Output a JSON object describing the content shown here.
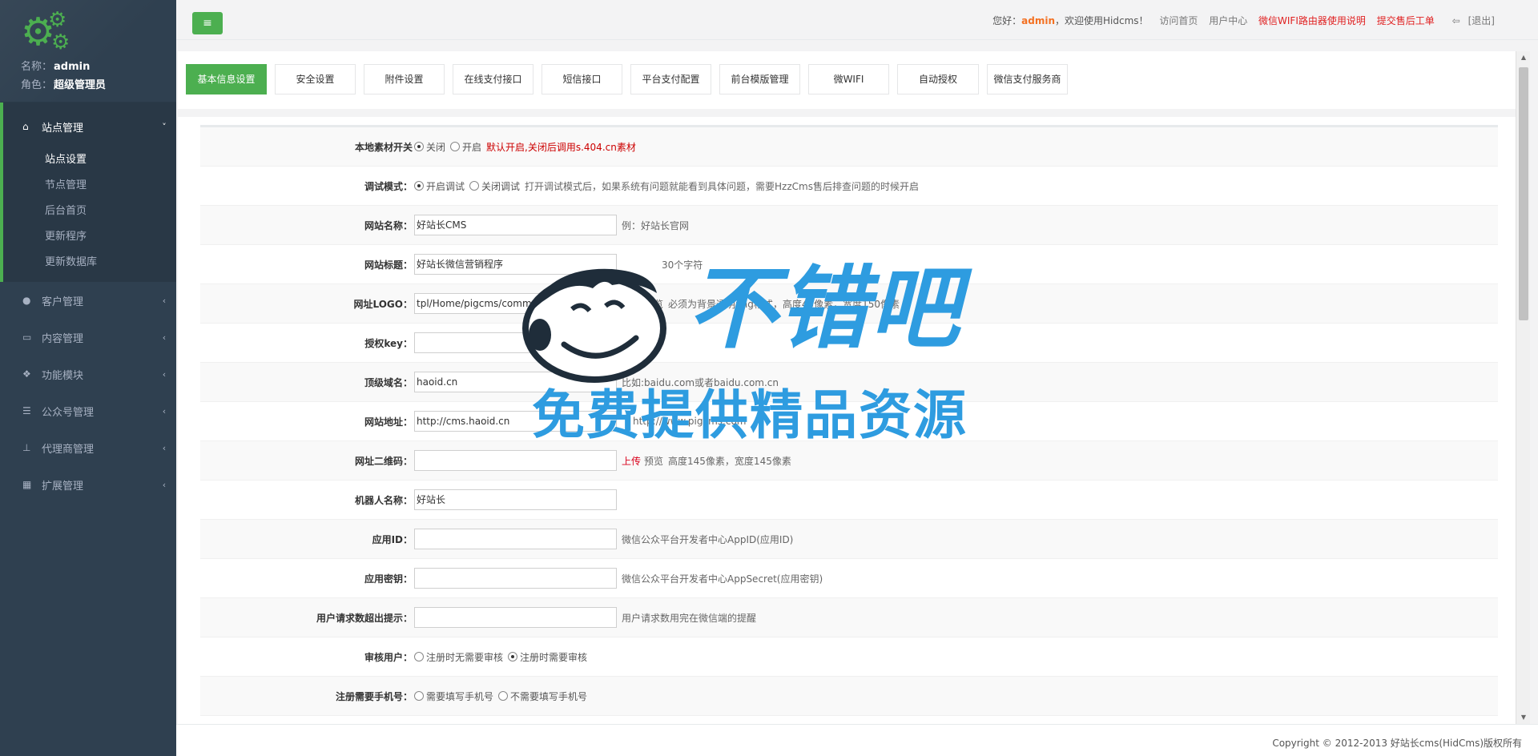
{
  "sidebar": {
    "name_label": "名称：",
    "name_value": "admin",
    "role_label": "角色：",
    "role_value": "超级管理员",
    "menu": [
      {
        "label": "站点管理",
        "icon": "home-icon",
        "arrow": "˅"
      },
      {
        "label": "客户管理",
        "icon": "user-icon",
        "arrow": "‹"
      },
      {
        "label": "内容管理",
        "icon": "card-icon",
        "arrow": "‹"
      },
      {
        "label": "功能模块",
        "icon": "cubes-icon",
        "arrow": "‹"
      },
      {
        "label": "公众号管理",
        "icon": "list-icon",
        "arrow": "‹"
      },
      {
        "label": "代理商管理",
        "icon": "sitemap-icon",
        "arrow": "‹"
      },
      {
        "label": "扩展管理",
        "icon": "grid-icon",
        "arrow": "‹"
      }
    ],
    "submenu": [
      "站点设置",
      "节点管理",
      "后台首页",
      "更新程序",
      "更新数据库"
    ]
  },
  "topbar": {
    "greeting": "您好：",
    "user": "admin",
    "welcome": "，欢迎使用Hidcms！",
    "links": [
      "访问首页",
      "用户中心"
    ],
    "red_links": [
      "微信WIFI路由器使用说明",
      "提交售后工单"
    ],
    "logout": "[退出]",
    "menu_icon": "≡"
  },
  "tabs": [
    "基本信息设置",
    "安全设置",
    "附件设置",
    "在线支付接口",
    "短信接口",
    "平台支付配置",
    "前台模版管理",
    "微WIFI",
    "自动授权",
    "微信支付服务商"
  ],
  "form": {
    "local_material": {
      "label": "本地素材开关",
      "opt1": "关闭",
      "opt2": "开启",
      "hint": "默认开启,关闭后调用s.404.cn素材"
    },
    "debug": {
      "label": "调试模式：",
      "opt1": "开启调试",
      "opt2": "关闭调试",
      "hint": "打开调试模式后，如果系统有问题就能看到具体问题，需要HzzCms售后排查问题的时候开启"
    },
    "site_name": {
      "label": "网站名称：",
      "value": "好站长CMS",
      "hint": "例：好站长官网"
    },
    "site_title": {
      "label": "网站标题：",
      "value": "好站长微信营销程序",
      "hint": "30个字符"
    },
    "logo": {
      "label": "网址LOGO：",
      "value": "tpl/Home/pigcms/common/images/logo-pigcms.png",
      "upload": "上传",
      "preview": "预览",
      "hint": "必须为背景透明png格式，高度45像素，宽度150像素"
    },
    "auth_key": {
      "label": "授权key：",
      "value": ""
    },
    "top_domain": {
      "label": "顶级域名：",
      "value": "haoid.cn",
      "hint": "比如:baidu.com或者baidu.com.cn"
    },
    "site_url": {
      "label": "网站地址：",
      "value": "http://cms.haoid.cn",
      "hint": "http://www.pigcms.com"
    },
    "qrcode": {
      "label": "网址二维码：",
      "value": "",
      "upload": "上传",
      "preview": "预览",
      "hint": "高度145像素，宽度145像素"
    },
    "robot": {
      "label": "机器人名称：",
      "value": "好站长"
    },
    "appid": {
      "label": "应用ID：",
      "value": "",
      "hint": "微信公众平台开发者中心AppID(应用ID)"
    },
    "appsecret": {
      "label": "应用密钥：",
      "value": "",
      "hint": "微信公众平台开发者中心AppSecret(应用密钥)"
    },
    "over_limit": {
      "label": "用户请求数超出提示：",
      "value": "",
      "hint": "用户请求数用完在微信端的提醒"
    },
    "audit": {
      "label": "审核用户：",
      "opt1": "注册时无需要审核",
      "opt2": "注册时需要审核"
    },
    "phone": {
      "label": "注册需要手机号：",
      "opt1": "需要填写手机号",
      "opt2": "不需要填写手机号"
    }
  },
  "footer": {
    "copyright": "Copyright © 2012-2013 好站长cms(HidCms)版权所有"
  },
  "watermark": {
    "title": "不错吧",
    "subtitle": "免费提供精品资源"
  },
  "colors": {
    "accent": "#4caf50",
    "sidebar": "#2f4050",
    "watermark": "#2e9ce0"
  }
}
